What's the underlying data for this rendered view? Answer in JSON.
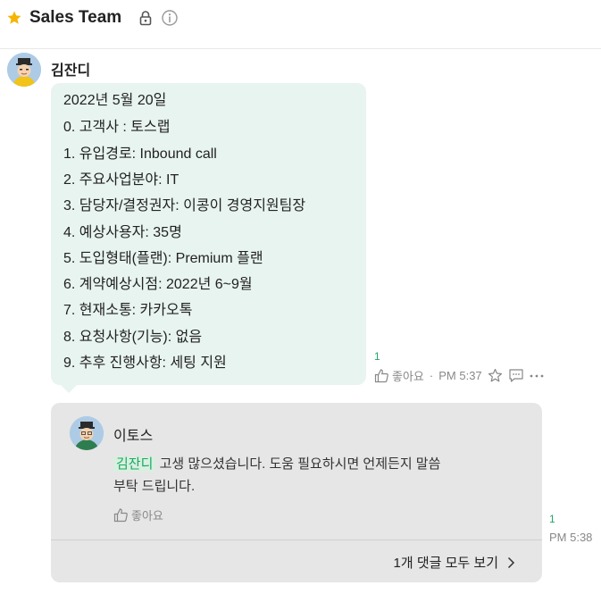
{
  "header": {
    "title": "Sales Team",
    "star_color": "#f5b400",
    "icons": [
      "star-icon",
      "lock-icon",
      "info-icon"
    ]
  },
  "message": {
    "sender": "김잔디",
    "lines": [
      "2022년 5월 20일",
      "0. 고객사 : 토스랩",
      "1. 유입경로: Inbound call",
      "2. 주요사업분야: IT",
      "3. 담당자/결정권자: 이콩이 경영지원팀장",
      "4. 예상사용자: 35명",
      "5. 도입형태(플랜): Premium 플랜",
      "6. 계약예상시점: 2022년 6~9월",
      "7. 현재소통: 카카오톡",
      "8. 요청사항(기능):  없음",
      "9. 추후 진행사항:  세팅 지원"
    ],
    "unread_count": "1",
    "like_label": "좋아요",
    "separator": "·",
    "time": "PM 5:37",
    "bubble_color": "#e8f4ef"
  },
  "reply": {
    "sender": "이토스",
    "mention": "김잔디",
    "text_line1": " 고생 많으셨습니다. 도움 필요하시면 언제든지 말씀",
    "text_line2": "부탁 드립니다.",
    "like_label": "좋아요",
    "view_all_label": "1개 댓글 모두 보기",
    "unread_count": "1",
    "time": "PM 5:38",
    "card_color": "#e6e6e6",
    "mention_color": "#1aa865"
  }
}
